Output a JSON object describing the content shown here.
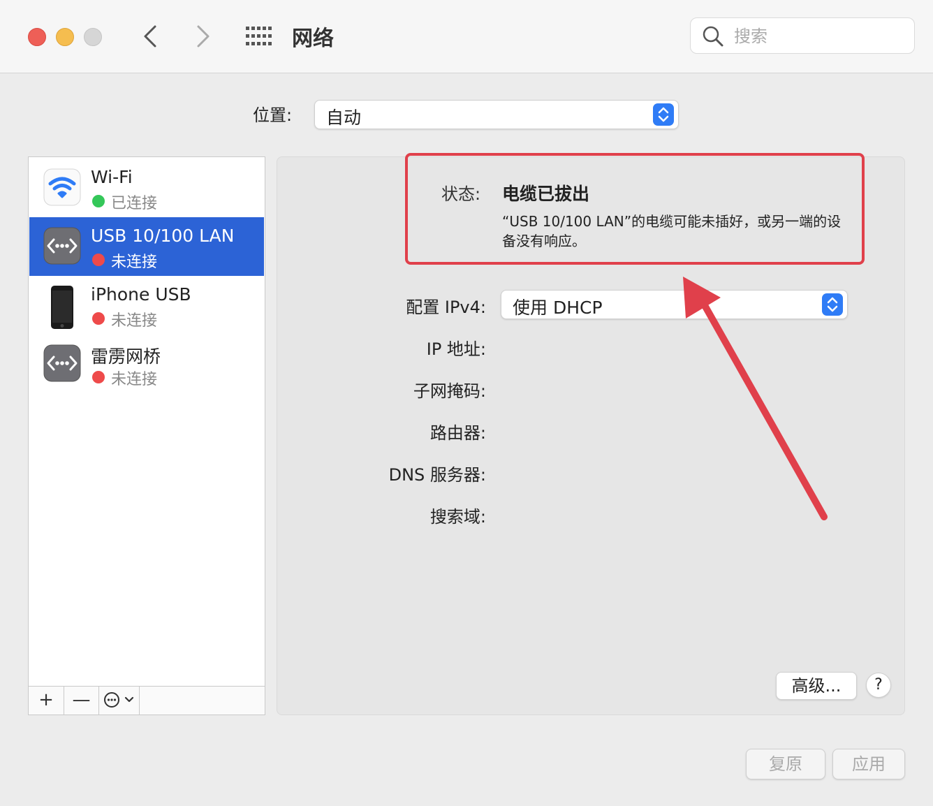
{
  "window": {
    "title": "网络",
    "search": {
      "placeholder": "搜索",
      "value": ""
    }
  },
  "location": {
    "label": "位置:",
    "value": "自动"
  },
  "services": [
    {
      "name": "Wi-Fi",
      "status": "已连接",
      "status_color": "#34c759",
      "icon": "wifi-icon",
      "selected": false
    },
    {
      "name": "USB 10/100 LAN",
      "status": "未连接",
      "status_color": "#ee4a4a",
      "icon": "ethernet-icon",
      "selected": true
    },
    {
      "name": "iPhone USB",
      "status": "未连接",
      "status_color": "#ee4a4a",
      "icon": "iphone-icon",
      "selected": false
    },
    {
      "name": "雷雳网桥",
      "status": "未连接",
      "status_color": "#ee4a4a",
      "icon": "ethernet-icon",
      "selected": false
    }
  ],
  "sidebar_toolbar": {
    "add": "+",
    "remove": "—"
  },
  "detail": {
    "status_label": "状态:",
    "status_value": "电缆已拔出",
    "status_description": "“USB 10/100 LAN”的电缆可能未插好，或另一端的设备没有响应。",
    "ipv4_label": "配置 IPv4:",
    "ipv4_value": "使用 DHCP",
    "ip_label": "IP 地址:",
    "subnet_label": "子网掩码:",
    "router_label": "路由器:",
    "dns_label": "DNS 服务器:",
    "search_domain_label": "搜索域:"
  },
  "buttons": {
    "advanced": "高级...",
    "help": "?",
    "revert": "复原",
    "apply": "应用"
  },
  "colors": {
    "accent": "#2f7cf6",
    "selection": "#2c63d6",
    "annotation": "#e0404b"
  }
}
